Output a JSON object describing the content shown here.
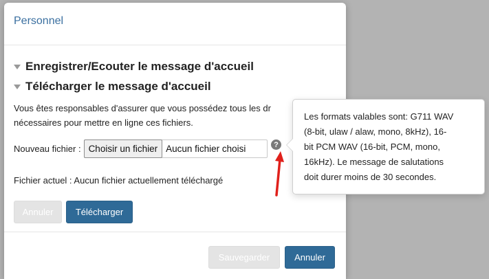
{
  "modal": {
    "title": "Personnel",
    "sections": {
      "record": "Enregistrer/Ecouter le message d'accueil",
      "upload": "Télécharger le message d'accueil"
    },
    "notice_line1": "Vous êtes responsables d'assurer que vous possédez tous les dr",
    "notice_line2": "nécessaires pour mettre en ligne ces fichiers.",
    "file": {
      "label": "Nouveau fichier :",
      "choose_button": "Choisir un fichier",
      "status": "Aucun fichier choisi"
    },
    "help_icon_glyph": "?",
    "current_file": "Fichier actuel : Aucun fichier actuellement téléchargé",
    "upload_actions": {
      "cancel": "Annuler",
      "upload": "Télécharger"
    },
    "footer": {
      "save": "Sauvegarder",
      "cancel": "Annuler"
    }
  },
  "tooltip": {
    "lines": [
      "Les formats valables sont: G711 WAV",
      "(8-bit, ulaw / alaw, mono, 8kHz), 16-",
      "bit PCM WAV (16-bit, PCM, mono,",
      "16kHz). Le message de salutations",
      "doit durer moins de 30 secondes."
    ]
  },
  "colors": {
    "primary": "#2f6a97",
    "title": "#3a6fa0",
    "annotation_arrow": "#e0201b"
  }
}
